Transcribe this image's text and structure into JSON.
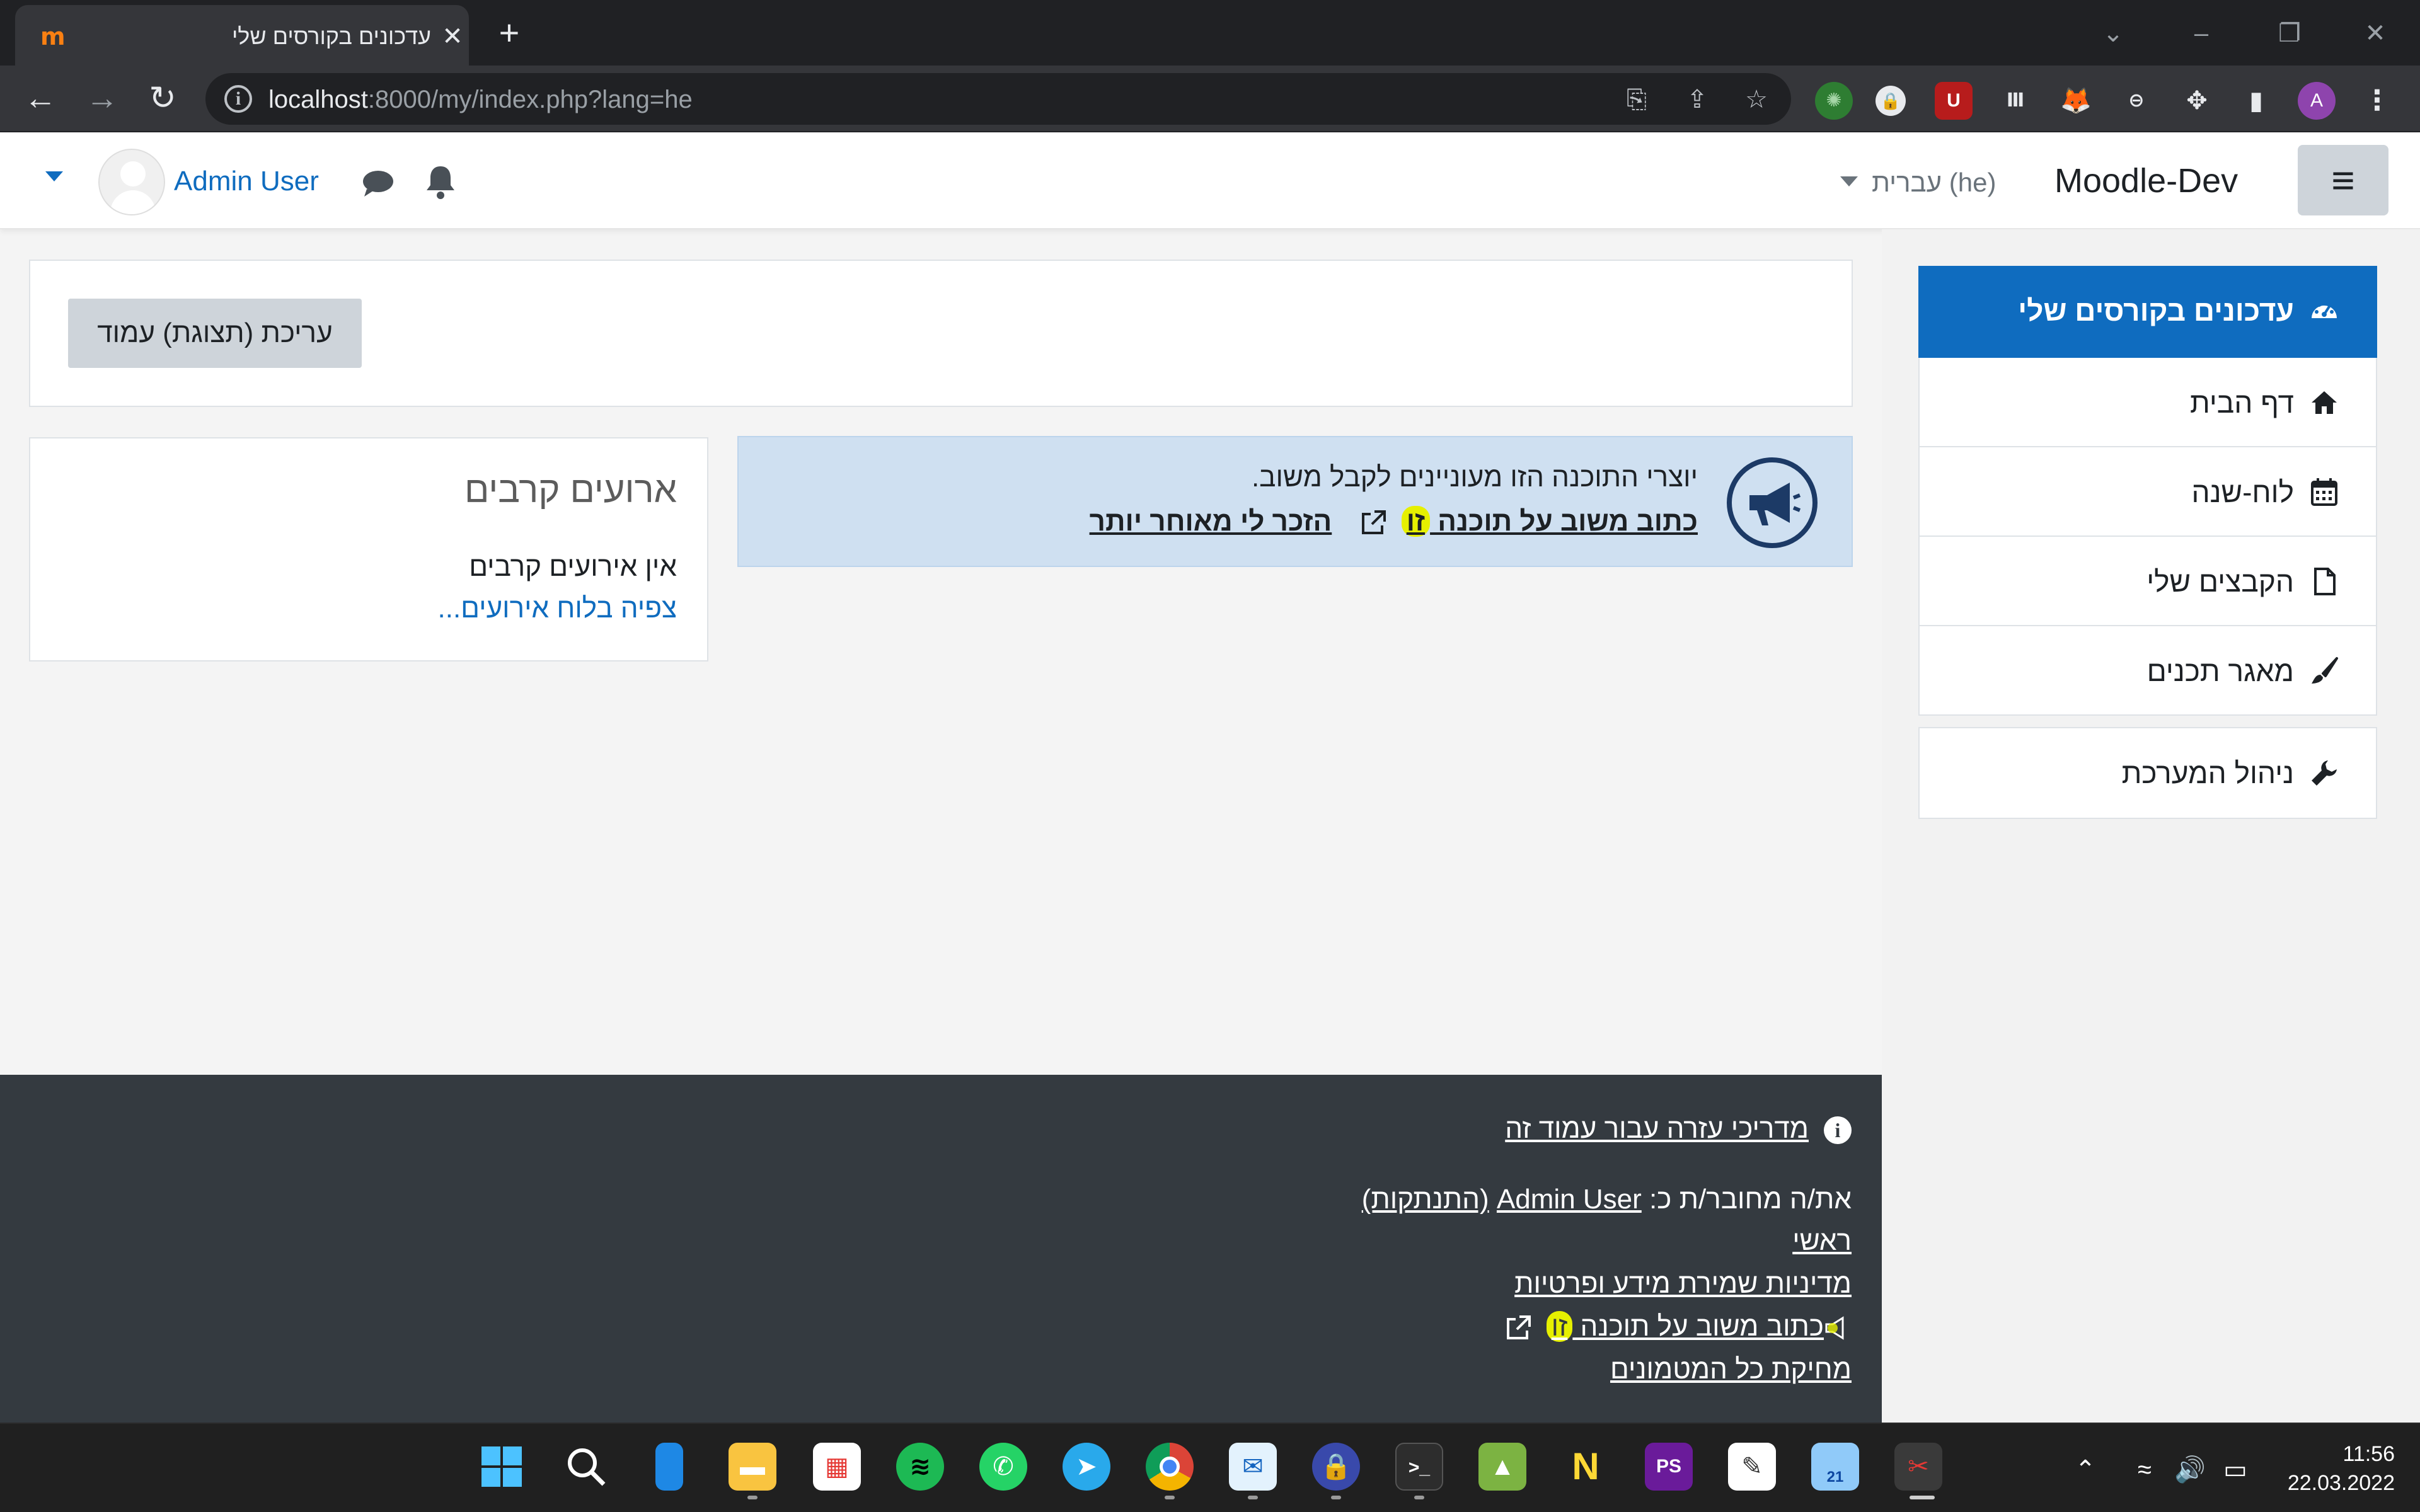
{
  "browser": {
    "tab_title": "עדכונים בקורסים שלי",
    "tab_favicon": "m",
    "new_tab_label": "+",
    "url_host": "localhost",
    "url_rest": ":8000/my/index.php?lang=he",
    "profile_initial": "A"
  },
  "navbar": {
    "site_name": "Moodle-Dev",
    "language": "עברית (he)",
    "user_name": "Admin User"
  },
  "drawer": {
    "items": [
      {
        "label": "עדכונים בקורסים שלי",
        "icon": "dashboard-icon",
        "active": true
      },
      {
        "label": "דף הבית",
        "icon": "home-icon"
      },
      {
        "label": "לוח-שנה",
        "icon": "calendar-icon"
      },
      {
        "label": "הקבצים שלי",
        "icon": "file-icon"
      },
      {
        "label": "מאגר תכנים",
        "icon": "paintbrush-icon"
      }
    ],
    "admin_item": {
      "label": "ניהול המערכת",
      "icon": "wrench-icon"
    }
  },
  "main": {
    "edit_page_button": "עריכת (תצוגת) עמוד",
    "feedback": {
      "text": "יוצרי התוכנה הזו מעוניינים לקבל משוב.",
      "link_prefix": "כתוב משוב על תוכנה ",
      "link_highlight": "זו",
      "remind_link": "הזכר לי מאוחר יותר"
    },
    "events": {
      "title": "ארועים קרבים",
      "no_events": "אין אירועים קרבים",
      "calendar_link": "צפיה בלוח אירועים..."
    }
  },
  "footer": {
    "help_link": "מדריכי עזרה עבור עמוד זה",
    "logged_in_prefix": "את/ה מחובר/ת כ: ",
    "logged_in_user": "Admin User",
    "logout_link": "(התנתקות)",
    "home_link": "ראשי",
    "privacy_link": "מדיניות שמירת מידע ופרטיות",
    "feedback_prefix": "כתוב משוב על תוכנה ",
    "feedback_highlight": "זו",
    "purge_link": "מחיקת כל המטמונים"
  },
  "taskbar": {
    "time": "11:56",
    "date": "22.03.2022",
    "calendar_badge": "21"
  },
  "colors": {
    "moodle_blue": "#0f6cbf",
    "footer_bg": "#343a40",
    "alert_bg": "#cfe0f1",
    "highlight": "#e6f000"
  }
}
